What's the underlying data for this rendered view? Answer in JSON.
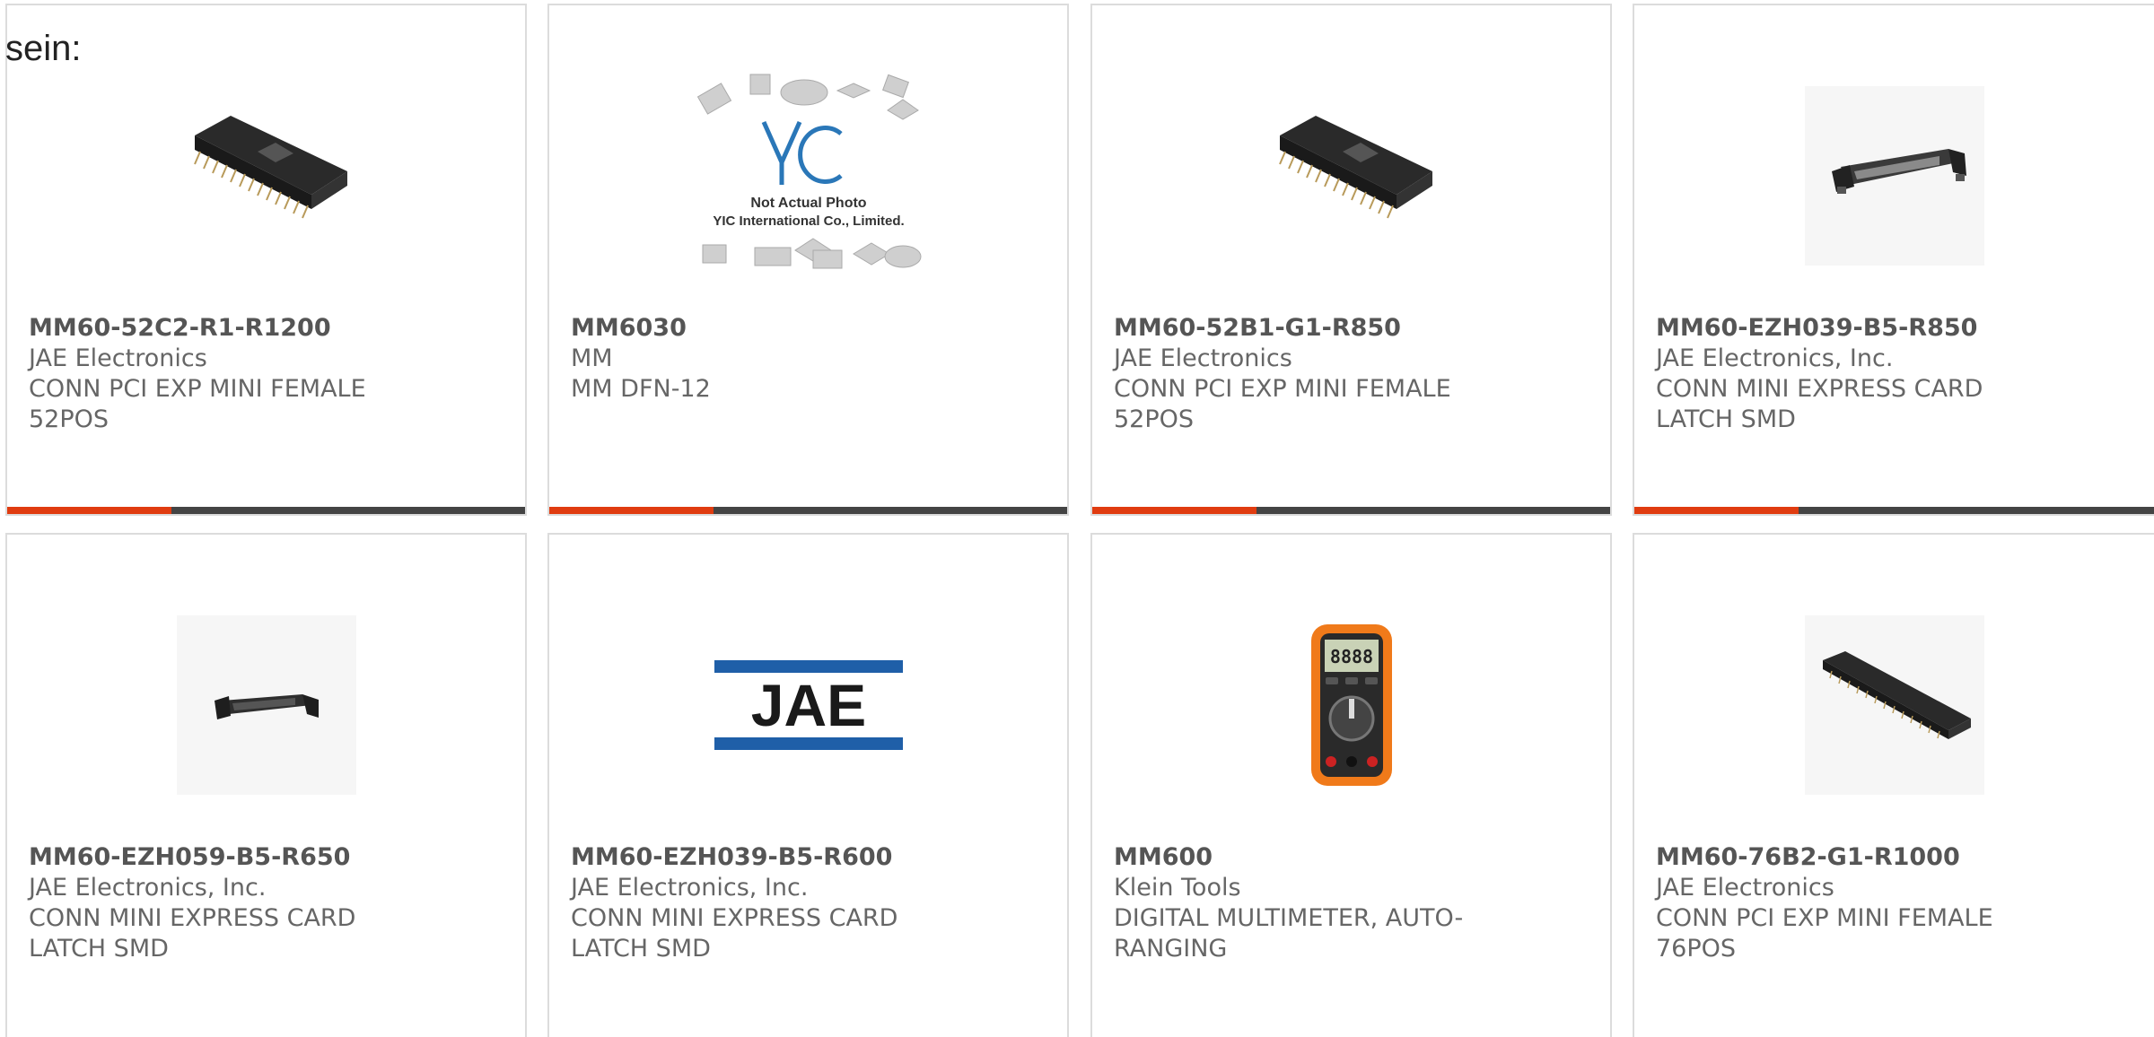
{
  "intro": "sein:",
  "colors": {
    "accent": "#e03c10",
    "bar": "#444444",
    "border": "#dcdcdc"
  },
  "cards": [
    {
      "part": "MM60-52C2-R1-R1200",
      "maker": "JAE Electronics",
      "desc": [
        "CONN PCI EXP MINI FEMALE",
        "52POS"
      ],
      "image": "black-edge-connector"
    },
    {
      "part": "MM6030",
      "maker": "MM",
      "desc": [
        "MM DFN-12",
        ""
      ],
      "image": "placeholder-yic",
      "image_text": {
        "logo": "YIC",
        "line1": "Not Actual Photo",
        "line2": "YIC International Co., Limited."
      }
    },
    {
      "part": "MM60-52B1-G1-R850",
      "maker": "JAE Electronics",
      "desc": [
        "CONN PCI EXP MINI FEMALE",
        "52POS"
      ],
      "image": "black-edge-connector"
    },
    {
      "part": "MM60-EZH039-B5-R850",
      "maker": "JAE Electronics, Inc.",
      "desc": [
        "CONN MINI EXPRESS CARD",
        "LATCH SMD"
      ],
      "image": "card-latch"
    },
    {
      "part": "MM60-EZH059-B5-R650",
      "maker": "JAE Electronics, Inc.",
      "desc": [
        "CONN MINI EXPRESS CARD",
        "LATCH SMD"
      ],
      "image": "card-latch-small"
    },
    {
      "part": "MM60-EZH039-B5-R600",
      "maker": "JAE Electronics, Inc.",
      "desc": [
        "CONN MINI EXPRESS CARD",
        "LATCH SMD"
      ],
      "image": "jae-logo",
      "image_text": {
        "logo": "JAE"
      }
    },
    {
      "part": "MM600",
      "maker": "Klein Tools",
      "desc": [
        "DIGITAL MULTIMETER, AUTO-",
        "RANGING"
      ],
      "image": "multimeter",
      "image_text": {
        "display": "8888"
      }
    },
    {
      "part": "MM60-76B2-G1-R1000",
      "maker": "JAE Electronics",
      "desc": [
        "CONN PCI EXP MINI FEMALE",
        "76POS"
      ],
      "image": "long-edge-connector"
    }
  ]
}
